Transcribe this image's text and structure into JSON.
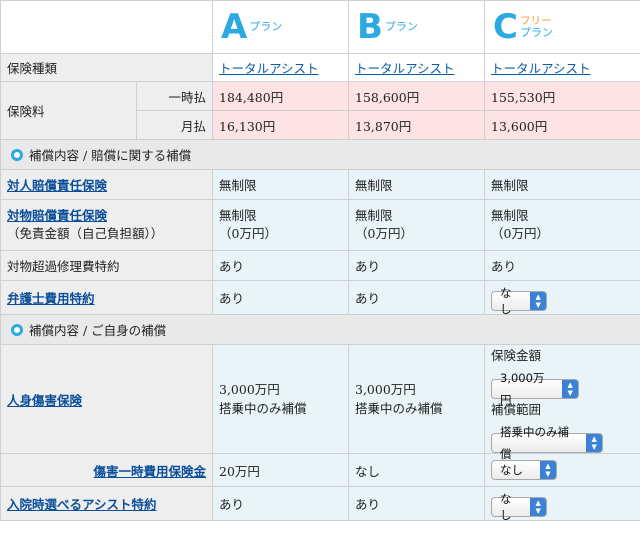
{
  "plans": [
    {
      "letter": "A",
      "suffix": "プラン",
      "free": ""
    },
    {
      "letter": "B",
      "suffix": "プラン",
      "free": ""
    },
    {
      "letter": "C",
      "suffix": "プラン",
      "free": "フリー"
    }
  ],
  "insurance_type": {
    "label": "保険種類",
    "values": [
      "トータルアシスト",
      "トータルアシスト",
      "トータルアシスト"
    ]
  },
  "premium": {
    "label": "保険料",
    "lump": {
      "label": "一時払",
      "values": [
        "184,480円",
        "158,600円",
        "155,530円"
      ]
    },
    "monthly": {
      "label": "月払",
      "values": [
        "16,130円",
        "13,870円",
        "13,600円"
      ]
    }
  },
  "section1": {
    "title": "補償内容 / 賠償に関する補償"
  },
  "bodily_liability": {
    "label": "対人賠償責任保険",
    "values": [
      "無制限",
      "無制限",
      "無制限"
    ]
  },
  "property_liability": {
    "label": "対物賠償責任保険",
    "sublabel": "（免責金額（自己負担額））",
    "values": [
      "無制限",
      "無制限",
      "無制限"
    ],
    "deductibles": [
      "（0万円）",
      "（0万円）",
      "（0万円）"
    ]
  },
  "property_excess": {
    "label": "対物超過修理費特約",
    "values": [
      "あり",
      "あり",
      "あり"
    ]
  },
  "lawyer": {
    "label": "弁護士費用特約",
    "values": [
      "あり",
      "あり"
    ],
    "select_c": "なし"
  },
  "section2": {
    "title": "補償内容 / ご自身の補償"
  },
  "personal_injury": {
    "label": "人身傷害保険",
    "a": [
      "3,000万円",
      "搭乗中のみ補償"
    ],
    "b": [
      "3,000万円",
      "搭乗中のみ補償"
    ],
    "c": {
      "amount_label": "保険金額",
      "amount_select": "3,000万円",
      "scope_label": "補償範囲",
      "scope_select": "搭乗中のみ補償"
    }
  },
  "injury_lump": {
    "label": "傷害一時費用保険金",
    "values": [
      "20万円",
      "なし"
    ],
    "select_c": "なし"
  },
  "hospital_assist": {
    "label": "入院時選べるアシスト特約",
    "values": [
      "あり",
      "あり"
    ],
    "select_c": "なし"
  }
}
